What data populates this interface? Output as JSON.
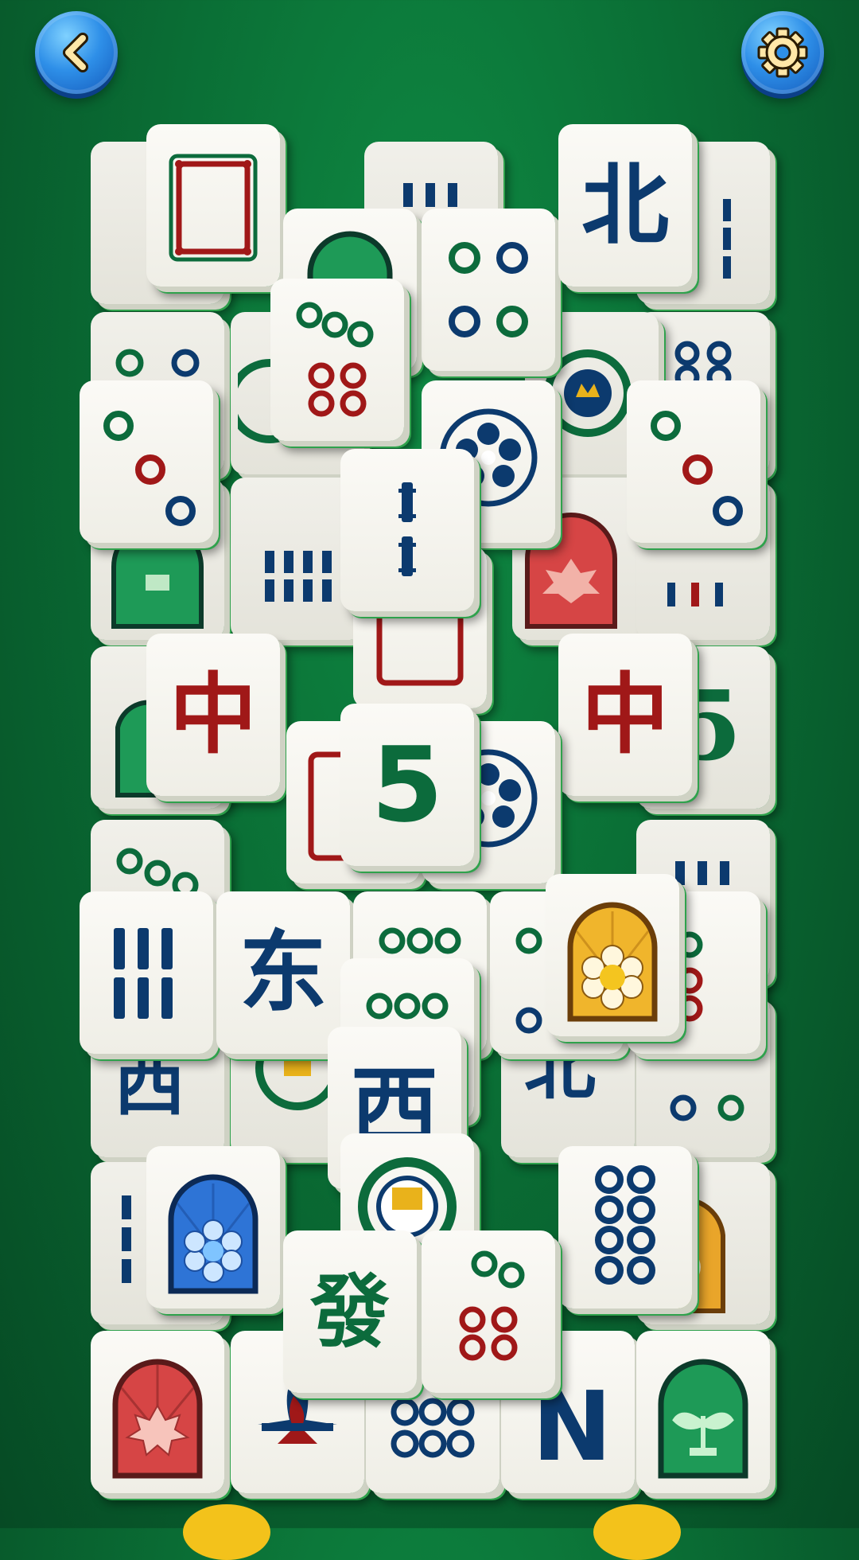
{
  "header": {
    "back_icon": "chevron-left-icon",
    "settings_icon": "gear-icon"
  },
  "colors": {
    "background": "#0a6e35",
    "button": "#2e8fe8",
    "tile_face": "#f5f4ee",
    "tile_edge": "#2fa24c",
    "char_red": "#a01818",
    "char_blue": "#0c3a6e",
    "char_green": "#0c6b3c"
  },
  "tiles": [
    {
      "kind": "bamboo",
      "value": "3"
    },
    {
      "kind": "circles",
      "value": "2"
    },
    {
      "kind": "bamboo",
      "value": "5"
    },
    {
      "kind": "flower",
      "value": "blue-flower"
    },
    {
      "kind": "circles",
      "value": "9"
    },
    {
      "kind": "season",
      "value": "orchid"
    },
    {
      "kind": "circles",
      "value": "7"
    },
    {
      "kind": "char",
      "value": "西"
    },
    {
      "kind": "dragon",
      "value": "white-dragon"
    },
    {
      "kind": "char",
      "value": "北"
    },
    {
      "kind": "circles",
      "value": "4"
    },
    {
      "kind": "circles",
      "value": "7"
    },
    {
      "kind": "circles",
      "value": "3"
    },
    {
      "kind": "flower",
      "value": "blue-flower"
    },
    {
      "kind": "circles",
      "value": "3"
    },
    {
      "kind": "bamboo",
      "value": "2"
    },
    {
      "kind": "char",
      "value": "中"
    },
    {
      "kind": "char",
      "value": "中"
    },
    {
      "kind": "char",
      "value": "5"
    },
    {
      "kind": "bamboo",
      "value": "9"
    },
    {
      "kind": "char",
      "value": "东"
    },
    {
      "kind": "circles",
      "value": "6"
    },
    {
      "kind": "season",
      "value": "chrysanthemum"
    },
    {
      "kind": "char",
      "value": "西"
    },
    {
      "kind": "season",
      "value": "plum"
    },
    {
      "kind": "circles",
      "value": "8"
    },
    {
      "kind": "char",
      "value": "發"
    },
    {
      "kind": "circles",
      "value": "7"
    },
    {
      "kind": "season",
      "value": "maple"
    },
    {
      "kind": "bamboo",
      "value": "1"
    },
    {
      "kind": "circles",
      "value": "9"
    },
    {
      "kind": "char",
      "value": "N"
    },
    {
      "kind": "season",
      "value": "bamboo-plant"
    }
  ]
}
